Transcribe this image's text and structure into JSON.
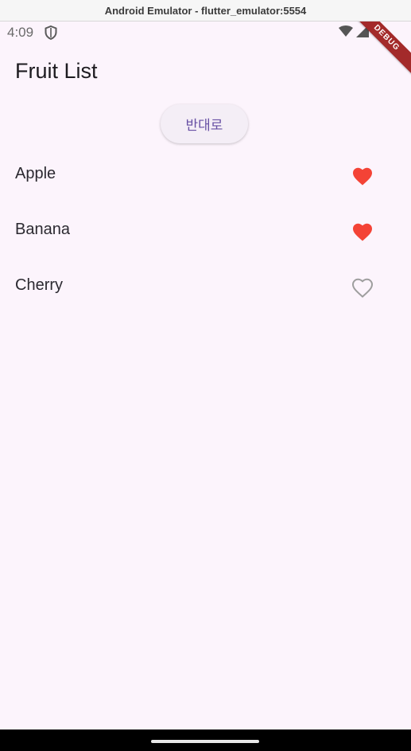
{
  "window": {
    "title": "Android Emulator - flutter_emulator:5554"
  },
  "status_bar": {
    "time": "4:09",
    "left_icon": "shield-icon",
    "right_icons": [
      "wifi-icon",
      "signal-icon"
    ]
  },
  "debug_banner": {
    "label": "DEBUG",
    "color": "#a32a2a"
  },
  "app_bar": {
    "title": "Fruit List"
  },
  "reverse_button": {
    "label": "반대로"
  },
  "fruits": [
    {
      "name": "Apple",
      "favorite": true
    },
    {
      "name": "Banana",
      "favorite": true
    },
    {
      "name": "Cherry",
      "favorite": false
    }
  ],
  "colors": {
    "favorite": "#f44336",
    "not_favorite": "#9e9e9e",
    "button_text": "#6750a4",
    "background": "#fcf4fc"
  }
}
